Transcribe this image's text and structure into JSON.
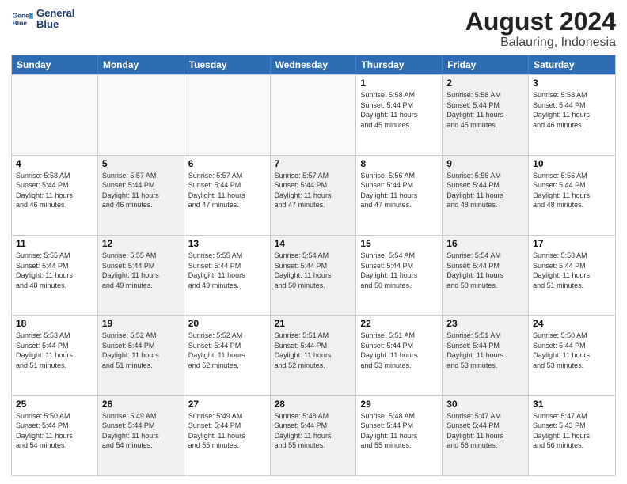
{
  "logo": {
    "line1": "General",
    "line2": "Blue"
  },
  "header": {
    "month": "August 2024",
    "location": "Balauring, Indonesia"
  },
  "weekdays": [
    "Sunday",
    "Monday",
    "Tuesday",
    "Wednesday",
    "Thursday",
    "Friday",
    "Saturday"
  ],
  "rows": [
    [
      {
        "day": "",
        "empty": true
      },
      {
        "day": "",
        "empty": true
      },
      {
        "day": "",
        "empty": true
      },
      {
        "day": "",
        "empty": true
      },
      {
        "day": "1",
        "info": "Sunrise: 5:58 AM\nSunset: 5:44 PM\nDaylight: 11 hours\nand 45 minutes."
      },
      {
        "day": "2",
        "info": "Sunrise: 5:58 AM\nSunset: 5:44 PM\nDaylight: 11 hours\nand 45 minutes.",
        "shaded": true
      },
      {
        "day": "3",
        "info": "Sunrise: 5:58 AM\nSunset: 5:44 PM\nDaylight: 11 hours\nand 46 minutes."
      }
    ],
    [
      {
        "day": "4",
        "info": "Sunrise: 5:58 AM\nSunset: 5:44 PM\nDaylight: 11 hours\nand 46 minutes."
      },
      {
        "day": "5",
        "info": "Sunrise: 5:57 AM\nSunset: 5:44 PM\nDaylight: 11 hours\nand 46 minutes.",
        "shaded": true
      },
      {
        "day": "6",
        "info": "Sunrise: 5:57 AM\nSunset: 5:44 PM\nDaylight: 11 hours\nand 47 minutes."
      },
      {
        "day": "7",
        "info": "Sunrise: 5:57 AM\nSunset: 5:44 PM\nDaylight: 11 hours\nand 47 minutes.",
        "shaded": true
      },
      {
        "day": "8",
        "info": "Sunrise: 5:56 AM\nSunset: 5:44 PM\nDaylight: 11 hours\nand 47 minutes."
      },
      {
        "day": "9",
        "info": "Sunrise: 5:56 AM\nSunset: 5:44 PM\nDaylight: 11 hours\nand 48 minutes.",
        "shaded": true
      },
      {
        "day": "10",
        "info": "Sunrise: 5:56 AM\nSunset: 5:44 PM\nDaylight: 11 hours\nand 48 minutes."
      }
    ],
    [
      {
        "day": "11",
        "info": "Sunrise: 5:55 AM\nSunset: 5:44 PM\nDaylight: 11 hours\nand 48 minutes."
      },
      {
        "day": "12",
        "info": "Sunrise: 5:55 AM\nSunset: 5:44 PM\nDaylight: 11 hours\nand 49 minutes.",
        "shaded": true
      },
      {
        "day": "13",
        "info": "Sunrise: 5:55 AM\nSunset: 5:44 PM\nDaylight: 11 hours\nand 49 minutes."
      },
      {
        "day": "14",
        "info": "Sunrise: 5:54 AM\nSunset: 5:44 PM\nDaylight: 11 hours\nand 50 minutes.",
        "shaded": true
      },
      {
        "day": "15",
        "info": "Sunrise: 5:54 AM\nSunset: 5:44 PM\nDaylight: 11 hours\nand 50 minutes."
      },
      {
        "day": "16",
        "info": "Sunrise: 5:54 AM\nSunset: 5:44 PM\nDaylight: 11 hours\nand 50 minutes.",
        "shaded": true
      },
      {
        "day": "17",
        "info": "Sunrise: 5:53 AM\nSunset: 5:44 PM\nDaylight: 11 hours\nand 51 minutes."
      }
    ],
    [
      {
        "day": "18",
        "info": "Sunrise: 5:53 AM\nSunset: 5:44 PM\nDaylight: 11 hours\nand 51 minutes."
      },
      {
        "day": "19",
        "info": "Sunrise: 5:52 AM\nSunset: 5:44 PM\nDaylight: 11 hours\nand 51 minutes.",
        "shaded": true
      },
      {
        "day": "20",
        "info": "Sunrise: 5:52 AM\nSunset: 5:44 PM\nDaylight: 11 hours\nand 52 minutes."
      },
      {
        "day": "21",
        "info": "Sunrise: 5:51 AM\nSunset: 5:44 PM\nDaylight: 11 hours\nand 52 minutes.",
        "shaded": true
      },
      {
        "day": "22",
        "info": "Sunrise: 5:51 AM\nSunset: 5:44 PM\nDaylight: 11 hours\nand 53 minutes."
      },
      {
        "day": "23",
        "info": "Sunrise: 5:51 AM\nSunset: 5:44 PM\nDaylight: 11 hours\nand 53 minutes.",
        "shaded": true
      },
      {
        "day": "24",
        "info": "Sunrise: 5:50 AM\nSunset: 5:44 PM\nDaylight: 11 hours\nand 53 minutes."
      }
    ],
    [
      {
        "day": "25",
        "info": "Sunrise: 5:50 AM\nSunset: 5:44 PM\nDaylight: 11 hours\nand 54 minutes."
      },
      {
        "day": "26",
        "info": "Sunrise: 5:49 AM\nSunset: 5:44 PM\nDaylight: 11 hours\nand 54 minutes.",
        "shaded": true
      },
      {
        "day": "27",
        "info": "Sunrise: 5:49 AM\nSunset: 5:44 PM\nDaylight: 11 hours\nand 55 minutes."
      },
      {
        "day": "28",
        "info": "Sunrise: 5:48 AM\nSunset: 5:44 PM\nDaylight: 11 hours\nand 55 minutes.",
        "shaded": true
      },
      {
        "day": "29",
        "info": "Sunrise: 5:48 AM\nSunset: 5:44 PM\nDaylight: 11 hours\nand 55 minutes."
      },
      {
        "day": "30",
        "info": "Sunrise: 5:47 AM\nSunset: 5:44 PM\nDaylight: 11 hours\nand 56 minutes.",
        "shaded": true
      },
      {
        "day": "31",
        "info": "Sunrise: 5:47 AM\nSunset: 5:43 PM\nDaylight: 11 hours\nand 56 minutes."
      }
    ]
  ]
}
